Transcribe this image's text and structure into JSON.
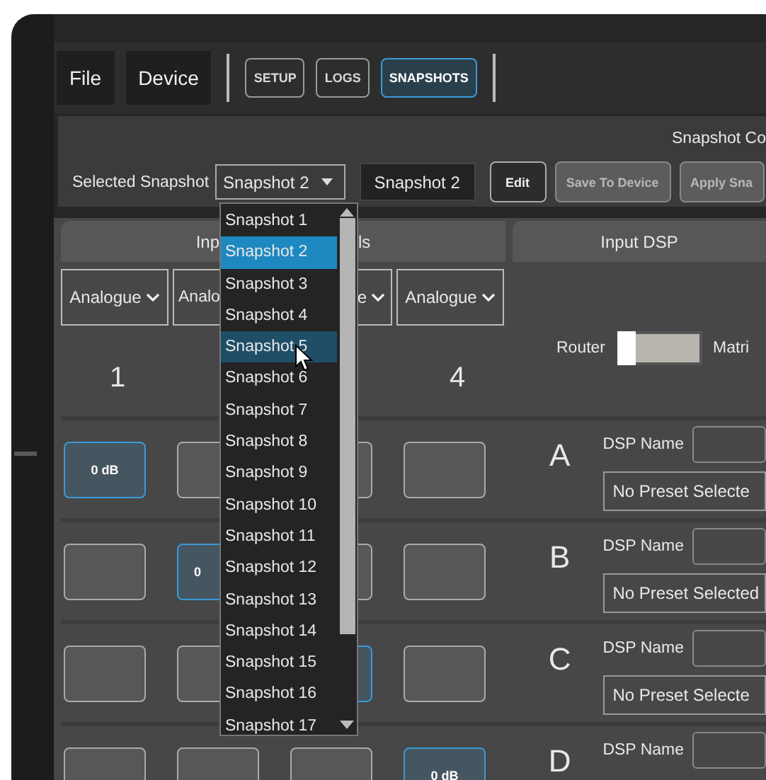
{
  "menu": [
    {
      "label": "File"
    },
    {
      "label": "Device"
    }
  ],
  "nav": [
    {
      "label": "SETUP",
      "selected": false
    },
    {
      "label": "LOGS",
      "selected": false
    },
    {
      "label": "SNAPSHOTS",
      "selected": true
    }
  ],
  "snapshot_panel": {
    "heading": "Snapshot Co",
    "selected_label": "Selected Snapshot",
    "select_value": "Snapshot 2",
    "name_value": "Snapshot 2",
    "buttons": [
      {
        "label": "Edit",
        "disabled": false
      },
      {
        "label": "Save To Device",
        "disabled": true
      },
      {
        "label": "Apply Sna",
        "disabled": true
      }
    ]
  },
  "tabs": [
    {
      "visible_parts": [
        "Inp",
        "ls"
      ]
    },
    {
      "visible_parts": [
        "Input DSP"
      ]
    }
  ],
  "source_selects": [
    {
      "text": "Analogue",
      "kind": "full"
    },
    {
      "text": "Analo",
      "kind": "start"
    },
    {
      "text": "e",
      "kind": "end"
    },
    {
      "text": "Analogue",
      "kind": "full"
    }
  ],
  "columns": [
    {
      "label": "1"
    },
    {},
    {},
    {
      "label": "4"
    }
  ],
  "router_toggle": {
    "left_label": "Router",
    "right_label": "Matri",
    "on": false
  },
  "rows": [
    {
      "letter": "A",
      "dsp_label": "DSP Name",
      "preset": "No Preset Selecte",
      "cells": [
        {
          "active": true,
          "text": "0 dB"
        },
        {
          "active": false
        },
        {
          "active": false
        },
        {
          "active": false
        }
      ]
    },
    {
      "letter": "B",
      "dsp_label": "DSP Name",
      "preset": "No Preset Selected",
      "cells": [
        {
          "active": false
        },
        {
          "active": true,
          "text": "0"
        },
        {
          "active": false
        },
        {
          "active": false
        }
      ]
    },
    {
      "letter": "C",
      "dsp_label": "DSP Name",
      "preset": "No Preset Selecte",
      "cells": [
        {
          "active": false
        },
        {
          "active": false
        },
        {
          "active": true
        },
        {
          "active": false
        }
      ]
    },
    {
      "letter": "D",
      "dsp_label": "DSP Name",
      "cells": [
        {
          "active": false
        },
        {
          "active": false
        },
        {
          "active": false
        },
        {
          "active": true,
          "text": "0 dB"
        }
      ]
    }
  ],
  "dropdown": {
    "items": [
      {
        "label": "Snapshot 1",
        "selected": false,
        "hovered": false
      },
      {
        "label": "Snapshot 2",
        "selected": true,
        "hovered": false
      },
      {
        "label": "Snapshot 3",
        "selected": false,
        "hovered": false
      },
      {
        "label": "Snapshot 4",
        "selected": false,
        "hovered": false
      },
      {
        "label": "Snapshot 5",
        "selected": false,
        "hovered": true
      },
      {
        "label": "Snapshot 6",
        "selected": false,
        "hovered": false
      },
      {
        "label": "Snapshot 7",
        "selected": false,
        "hovered": false
      },
      {
        "label": "Snapshot 8",
        "selected": false,
        "hovered": false
      },
      {
        "label": "Snapshot 9",
        "selected": false,
        "hovered": false
      },
      {
        "label": "Snapshot 10",
        "selected": false,
        "hovered": false
      },
      {
        "label": "Snapshot 11",
        "selected": false,
        "hovered": false
      },
      {
        "label": "Snapshot 12",
        "selected": false,
        "hovered": false
      },
      {
        "label": "Snapshot 13",
        "selected": false,
        "hovered": false
      },
      {
        "label": "Snapshot 14",
        "selected": false,
        "hovered": false
      },
      {
        "label": "Snapshot 15",
        "selected": false,
        "hovered": false
      },
      {
        "label": "Snapshot 16",
        "selected": false,
        "hovered": false
      },
      {
        "label": "Snapshot 17",
        "selected": false,
        "hovered": false
      }
    ]
  }
}
